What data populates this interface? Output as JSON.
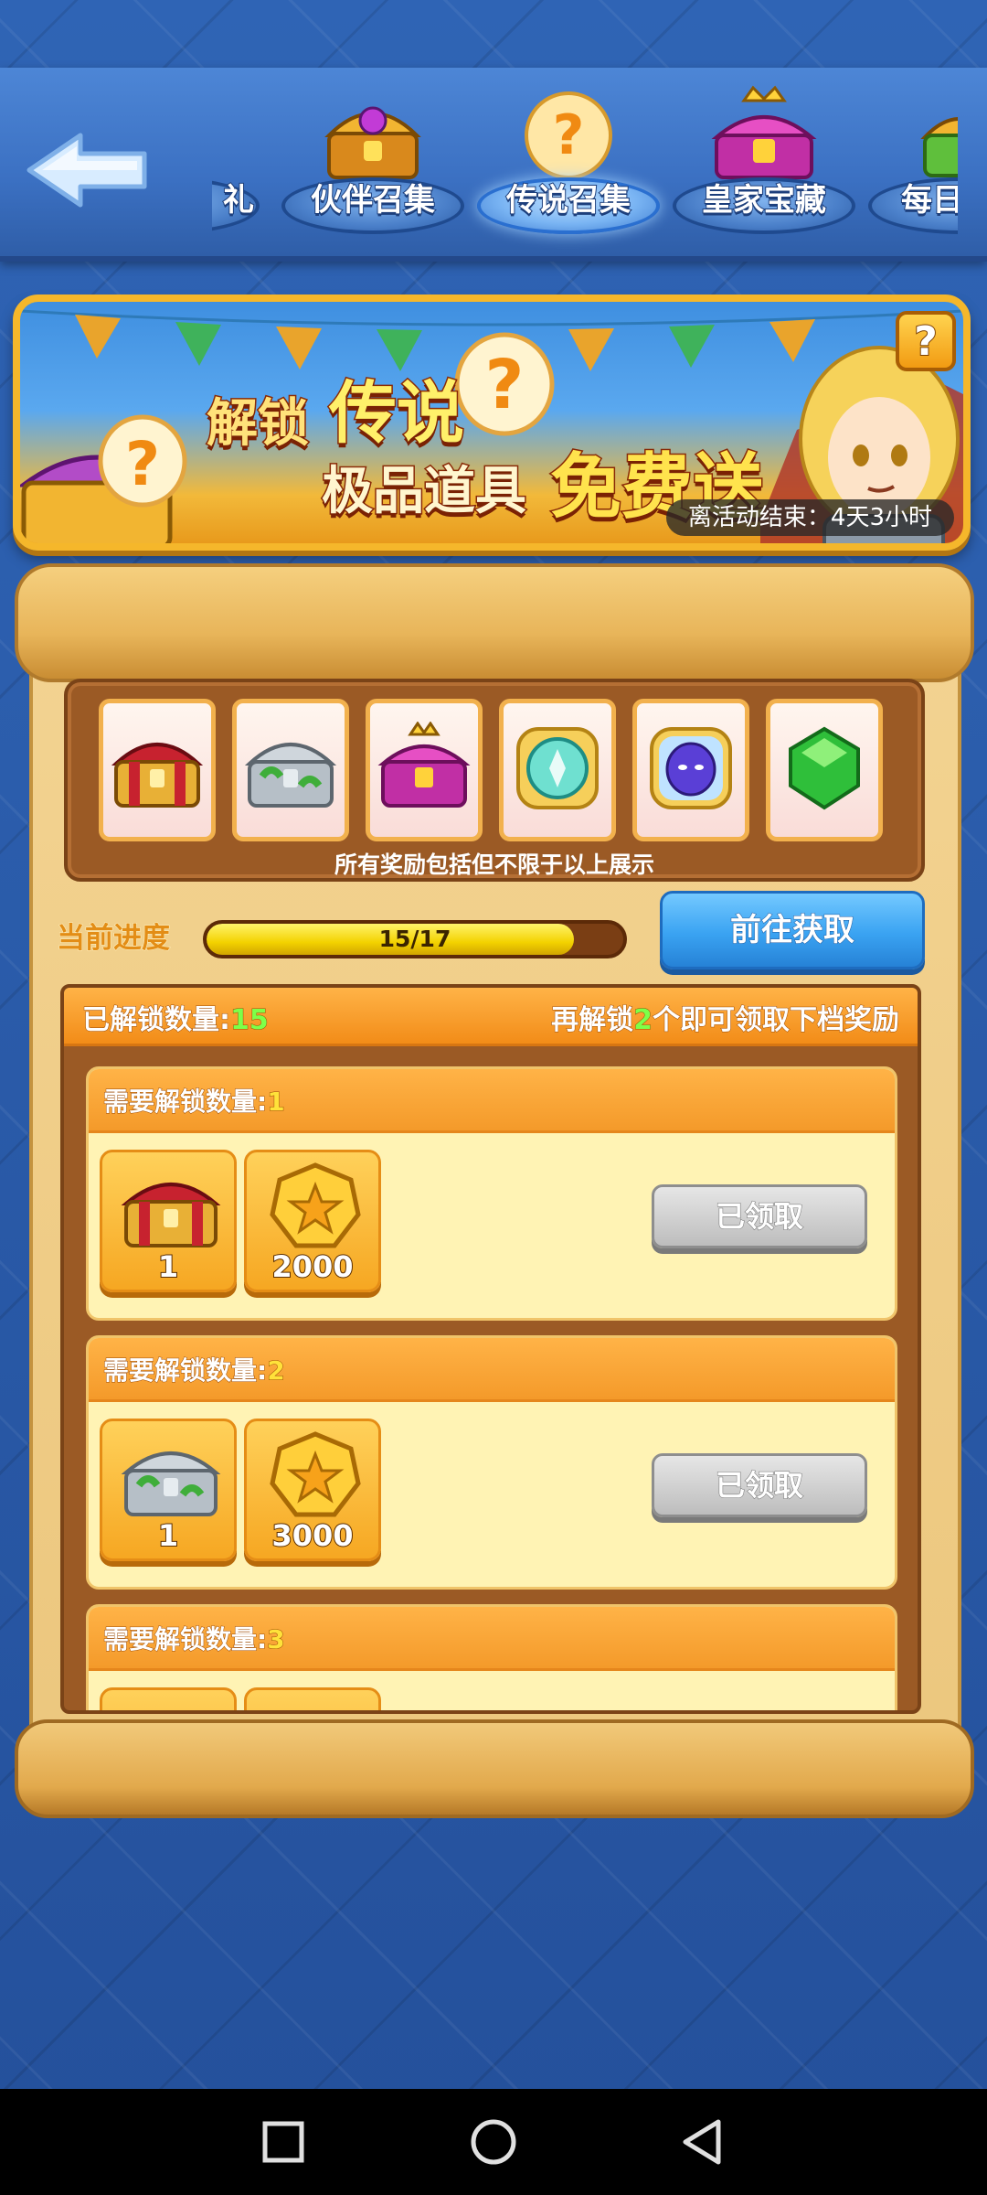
{
  "tabs": [
    {
      "label": "礼",
      "active": false
    },
    {
      "label": "伙伴召集",
      "active": false
    },
    {
      "label": "传说召集",
      "active": true
    },
    {
      "label": "皇家宝藏",
      "active": false
    },
    {
      "label": "每日",
      "active": false
    }
  ],
  "banner": {
    "line1_a": "解锁",
    "line1_b": "传说",
    "line2_a": "极品道具",
    "line2_b": "免费送",
    "help": "?",
    "timer": "离活动结束：4天3小时"
  },
  "preview": {
    "items": [
      "red-chest-icon",
      "silver-chest-icon",
      "purple-chest-icon",
      "teal-badge-icon",
      "blue-mask-icon",
      "green-gem-icon"
    ],
    "caption": "所有奖励包括但不限于以上展示"
  },
  "progress": {
    "label": "当前进度",
    "text": "15/17",
    "fraction": 0.882,
    "button": "前往获取"
  },
  "unlocked": {
    "prefix": "已解锁数量:",
    "count": "15",
    "right_prefix": "再解锁",
    "right_num": "2",
    "right_suffix": "个即可领取下档奖励"
  },
  "tiers": [
    {
      "label": "需要解锁数量:",
      "num": "1",
      "rewards": [
        {
          "icon": "red-chest-icon",
          "qty": "1"
        },
        {
          "icon": "gold-coin-icon",
          "qty": "2000"
        }
      ],
      "button": "已领取"
    },
    {
      "label": "需要解锁数量:",
      "num": "2",
      "rewards": [
        {
          "icon": "silver-chest-icon",
          "qty": "1"
        },
        {
          "icon": "gold-coin-icon",
          "qty": "3000"
        }
      ],
      "button": "已领取"
    },
    {
      "label": "需要解锁数量:",
      "num": "3",
      "rewards": [],
      "button": ""
    }
  ],
  "colors": {
    "accent_orange": "#f28c18",
    "button_blue": "#3aa3f2",
    "progress_yellow": "#f3d200",
    "bg_blue": "#2b5ba8"
  }
}
